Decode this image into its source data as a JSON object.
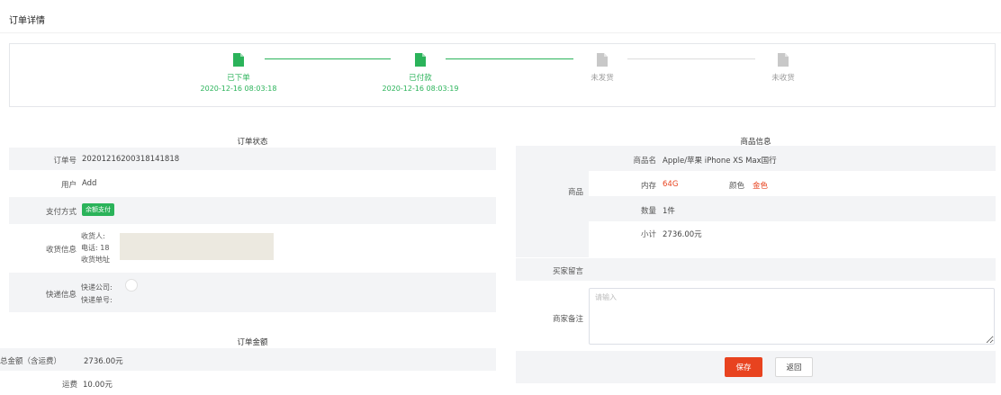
{
  "page": {
    "title": "订单详情"
  },
  "steps": [
    {
      "label": "已下单",
      "time": "2020-12-16 08:03:18",
      "status": "done",
      "icon": "document-icon"
    },
    {
      "label": "已付款",
      "time": "2020-12-16 08:03:19",
      "status": "done",
      "icon": "document-icon"
    },
    {
      "label": "未发货",
      "time": "",
      "status": "todo",
      "icon": "document-icon"
    },
    {
      "label": "未收货",
      "time": "",
      "status": "todo",
      "icon": "document-icon"
    }
  ],
  "order_status": {
    "title": "订单状态",
    "order_no_label": "订单号",
    "order_no": "20201216200318141818",
    "user_label": "用户",
    "user": "Add",
    "pay_label": "支付方式",
    "pay_badge": "余额支付",
    "receipt_label": "收货信息",
    "receiver_label": "收货人:",
    "phone_label": "电话: 18",
    "address_label": "收货地址",
    "express_label": "快递信息",
    "express_company_label": "快递公司:",
    "express_no_label": "快递单号:"
  },
  "order_amount": {
    "title": "订单金额",
    "total_label": "总金额（含运费）",
    "total": "2736.00元",
    "freight_label": "运费",
    "freight": "10.00元"
  },
  "goods": {
    "title": "商品信息",
    "section_label": "商品",
    "name_label": "商品名",
    "name": "Apple/苹果 iPhone XS Max国行",
    "storage_label": "内存",
    "storage": "64G",
    "color_label": "颜色",
    "color": "金色",
    "qty_label": "数量",
    "qty": "1件",
    "subtotal_label": "小计",
    "subtotal": "2736.00元",
    "buyer_msg_label": "买家留言",
    "merchant_note_label": "商家备注",
    "merchant_note_placeholder": "请输入"
  },
  "actions": {
    "save": "保存",
    "back": "返回"
  },
  "colors": {
    "accent_green": "#2bb35a",
    "accent_red": "#e8431f"
  }
}
